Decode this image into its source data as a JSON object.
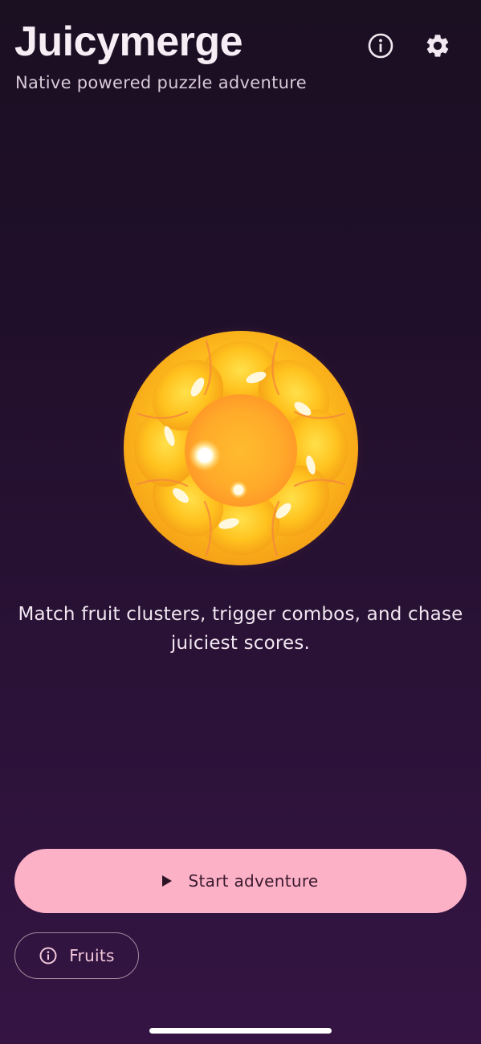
{
  "header": {
    "title": "Juicymerge",
    "subtitle": "Native powered puzzle adventure",
    "info_icon": "info-icon",
    "settings_icon": "gear-icon"
  },
  "main": {
    "fruit_icon": "orange-fruit",
    "tagline": "Match fruit clusters, trigger combos, and chase juiciest scores."
  },
  "actions": {
    "start_label": "Start adventure",
    "start_icon": "play-icon",
    "fruits_label": "Fruits",
    "fruits_icon": "info-icon"
  },
  "colors": {
    "background_top": "#1b0f22",
    "background_bottom": "#351443",
    "primary_button": "#fcb1c7",
    "fruit_yellow": "#ffc926",
    "fruit_orange": "#ff9d2a"
  }
}
